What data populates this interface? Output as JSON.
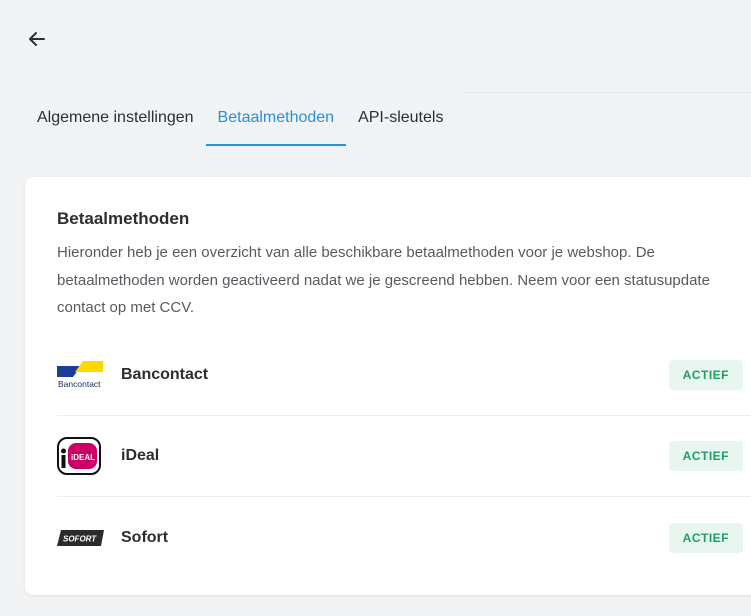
{
  "header": {
    "back_icon": "arrow-left-icon"
  },
  "tabs": [
    {
      "label": "Algemene instellingen",
      "active": false
    },
    {
      "label": "Betaalmethoden",
      "active": true
    },
    {
      "label": "API-sleutels",
      "active": false
    }
  ],
  "card": {
    "title": "Betaalmethoden",
    "description": "Hieronder heb je een overzicht van alle beschikbare betaalmethoden voor je webshop. De betaalmethoden worden geactiveerd nadat we je gescreend hebben. Neem voor een statusupdate contact op met CCV."
  },
  "methods": [
    {
      "name": "Bancontact",
      "status": "ACTIEF",
      "logo_text": "Bancontact",
      "icon": "bancontact-logo"
    },
    {
      "name": "iDeal",
      "status": "ACTIEF",
      "logo_text": "iDEAL",
      "icon": "ideal-logo"
    },
    {
      "name": "Sofort",
      "status": "ACTIEF",
      "logo_text": "SOFORT",
      "icon": "sofort-logo"
    }
  ],
  "colors": {
    "accent": "#2a8fd8",
    "badge_bg": "#e7f7ef",
    "badge_text": "#1e9e62",
    "ideal_pink": "#cc0066",
    "bancontact_blue": "#1e3c96",
    "bancontact_yellow": "#ffd800"
  }
}
